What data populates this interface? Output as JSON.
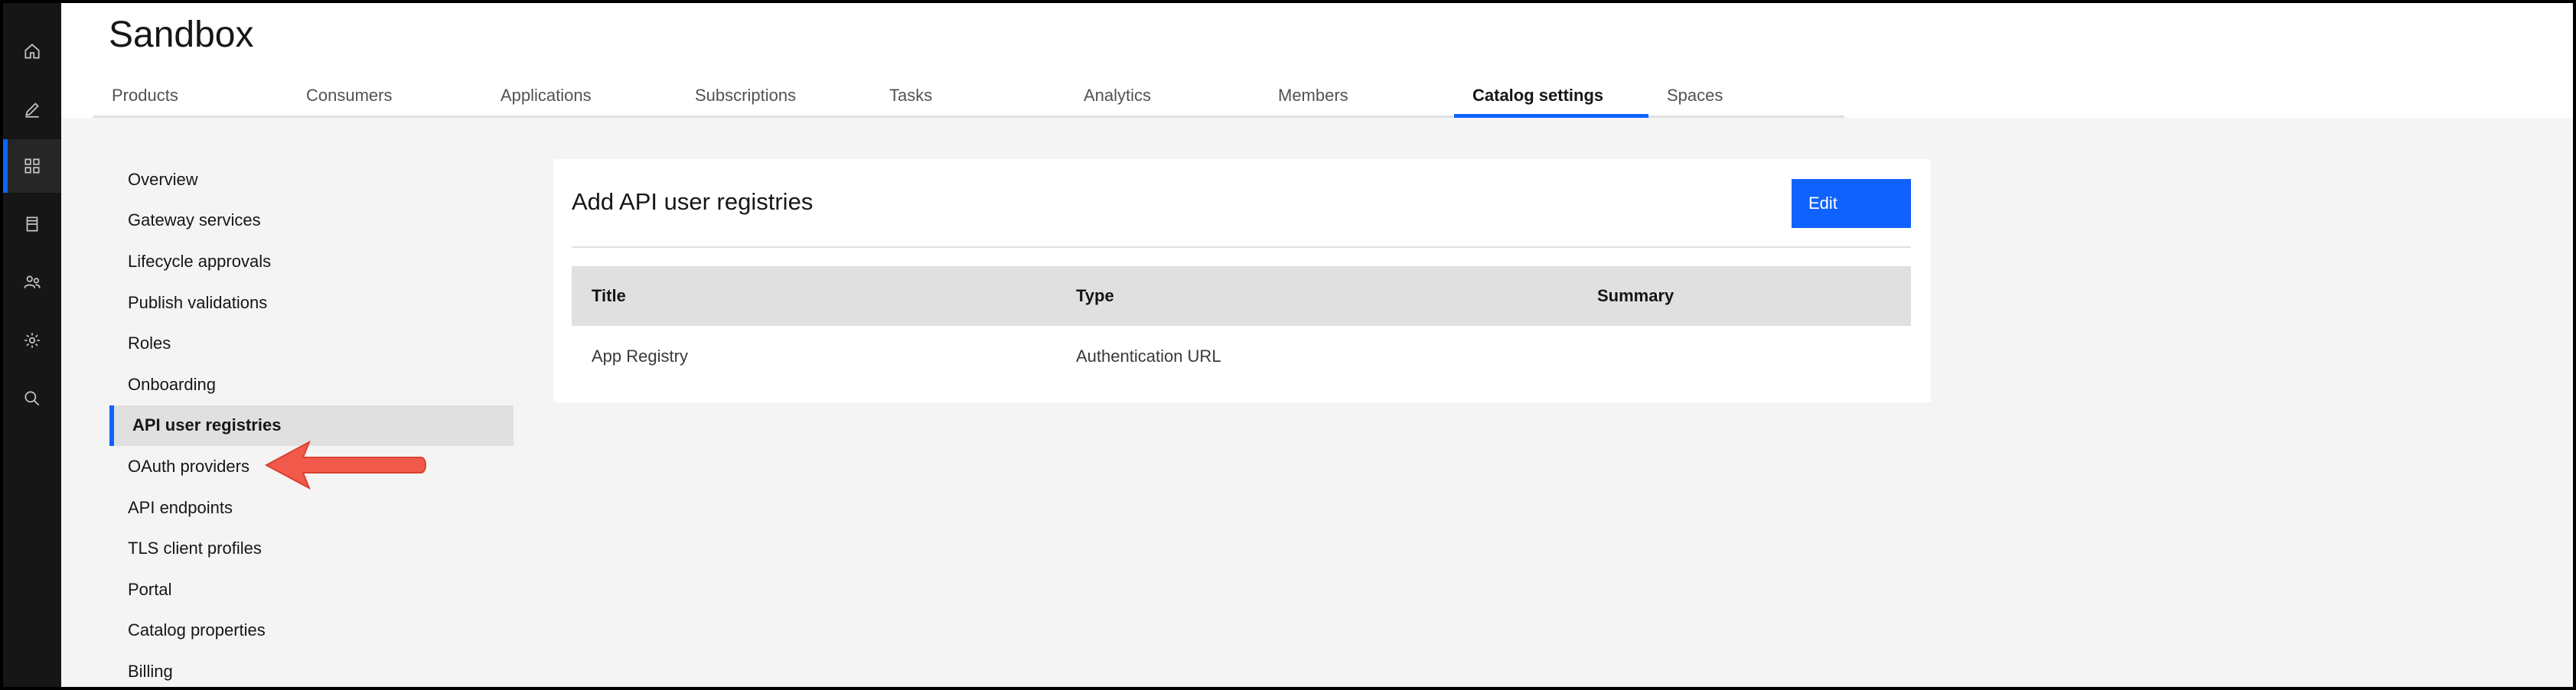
{
  "header": {
    "title": "Sandbox"
  },
  "tabs": [
    {
      "label": "Products"
    },
    {
      "label": "Consumers"
    },
    {
      "label": "Applications"
    },
    {
      "label": "Subscriptions"
    },
    {
      "label": "Tasks"
    },
    {
      "label": "Analytics"
    },
    {
      "label": "Members"
    },
    {
      "label": "Catalog settings",
      "active": true
    },
    {
      "label": "Spaces"
    }
  ],
  "rail": {
    "icons": [
      "home-icon",
      "edit-icon",
      "dashboard-icon",
      "catalog-icon",
      "members-icon",
      "settings-icon",
      "search-icon"
    ],
    "active": "dashboard-icon"
  },
  "sidenav": {
    "items": [
      {
        "label": "Overview"
      },
      {
        "label": "Gateway services"
      },
      {
        "label": "Lifecycle approvals"
      },
      {
        "label": "Publish validations"
      },
      {
        "label": "Roles"
      },
      {
        "label": "Onboarding"
      },
      {
        "label": "API user registries",
        "active": true
      },
      {
        "label": "OAuth providers"
      },
      {
        "label": "API endpoints"
      },
      {
        "label": "TLS client profiles"
      },
      {
        "label": "Portal"
      },
      {
        "label": "Catalog properties"
      },
      {
        "label": "Billing"
      }
    ]
  },
  "card": {
    "title": "Add API user registries",
    "edit_label": "Edit",
    "table": {
      "headers": [
        "Title",
        "Type",
        "Summary"
      ],
      "rows": [
        [
          "App Registry",
          "Authentication URL",
          ""
        ]
      ]
    }
  },
  "colors": {
    "accent": "#0f62fe",
    "rail_bg": "#161616",
    "annotation_arrow": "#f15a4a"
  }
}
